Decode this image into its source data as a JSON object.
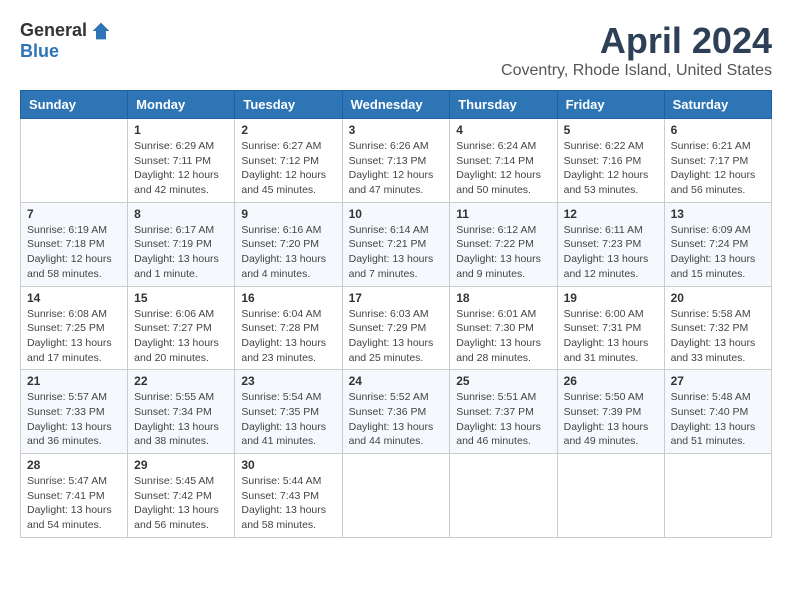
{
  "header": {
    "logo_general": "General",
    "logo_blue": "Blue",
    "month_title": "April 2024",
    "location": "Coventry, Rhode Island, United States"
  },
  "weekdays": [
    "Sunday",
    "Monday",
    "Tuesday",
    "Wednesday",
    "Thursday",
    "Friday",
    "Saturday"
  ],
  "weeks": [
    [
      {
        "day": "",
        "sunrise": "",
        "sunset": "",
        "daylight": ""
      },
      {
        "day": "1",
        "sunrise": "Sunrise: 6:29 AM",
        "sunset": "Sunset: 7:11 PM",
        "daylight": "Daylight: 12 hours and 42 minutes."
      },
      {
        "day": "2",
        "sunrise": "Sunrise: 6:27 AM",
        "sunset": "Sunset: 7:12 PM",
        "daylight": "Daylight: 12 hours and 45 minutes."
      },
      {
        "day": "3",
        "sunrise": "Sunrise: 6:26 AM",
        "sunset": "Sunset: 7:13 PM",
        "daylight": "Daylight: 12 hours and 47 minutes."
      },
      {
        "day": "4",
        "sunrise": "Sunrise: 6:24 AM",
        "sunset": "Sunset: 7:14 PM",
        "daylight": "Daylight: 12 hours and 50 minutes."
      },
      {
        "day": "5",
        "sunrise": "Sunrise: 6:22 AM",
        "sunset": "Sunset: 7:16 PM",
        "daylight": "Daylight: 12 hours and 53 minutes."
      },
      {
        "day": "6",
        "sunrise": "Sunrise: 6:21 AM",
        "sunset": "Sunset: 7:17 PM",
        "daylight": "Daylight: 12 hours and 56 minutes."
      }
    ],
    [
      {
        "day": "7",
        "sunrise": "Sunrise: 6:19 AM",
        "sunset": "Sunset: 7:18 PM",
        "daylight": "Daylight: 12 hours and 58 minutes."
      },
      {
        "day": "8",
        "sunrise": "Sunrise: 6:17 AM",
        "sunset": "Sunset: 7:19 PM",
        "daylight": "Daylight: 13 hours and 1 minute."
      },
      {
        "day": "9",
        "sunrise": "Sunrise: 6:16 AM",
        "sunset": "Sunset: 7:20 PM",
        "daylight": "Daylight: 13 hours and 4 minutes."
      },
      {
        "day": "10",
        "sunrise": "Sunrise: 6:14 AM",
        "sunset": "Sunset: 7:21 PM",
        "daylight": "Daylight: 13 hours and 7 minutes."
      },
      {
        "day": "11",
        "sunrise": "Sunrise: 6:12 AM",
        "sunset": "Sunset: 7:22 PM",
        "daylight": "Daylight: 13 hours and 9 minutes."
      },
      {
        "day": "12",
        "sunrise": "Sunrise: 6:11 AM",
        "sunset": "Sunset: 7:23 PM",
        "daylight": "Daylight: 13 hours and 12 minutes."
      },
      {
        "day": "13",
        "sunrise": "Sunrise: 6:09 AM",
        "sunset": "Sunset: 7:24 PM",
        "daylight": "Daylight: 13 hours and 15 minutes."
      }
    ],
    [
      {
        "day": "14",
        "sunrise": "Sunrise: 6:08 AM",
        "sunset": "Sunset: 7:25 PM",
        "daylight": "Daylight: 13 hours and 17 minutes."
      },
      {
        "day": "15",
        "sunrise": "Sunrise: 6:06 AM",
        "sunset": "Sunset: 7:27 PM",
        "daylight": "Daylight: 13 hours and 20 minutes."
      },
      {
        "day": "16",
        "sunrise": "Sunrise: 6:04 AM",
        "sunset": "Sunset: 7:28 PM",
        "daylight": "Daylight: 13 hours and 23 minutes."
      },
      {
        "day": "17",
        "sunrise": "Sunrise: 6:03 AM",
        "sunset": "Sunset: 7:29 PM",
        "daylight": "Daylight: 13 hours and 25 minutes."
      },
      {
        "day": "18",
        "sunrise": "Sunrise: 6:01 AM",
        "sunset": "Sunset: 7:30 PM",
        "daylight": "Daylight: 13 hours and 28 minutes."
      },
      {
        "day": "19",
        "sunrise": "Sunrise: 6:00 AM",
        "sunset": "Sunset: 7:31 PM",
        "daylight": "Daylight: 13 hours and 31 minutes."
      },
      {
        "day": "20",
        "sunrise": "Sunrise: 5:58 AM",
        "sunset": "Sunset: 7:32 PM",
        "daylight": "Daylight: 13 hours and 33 minutes."
      }
    ],
    [
      {
        "day": "21",
        "sunrise": "Sunrise: 5:57 AM",
        "sunset": "Sunset: 7:33 PM",
        "daylight": "Daylight: 13 hours and 36 minutes."
      },
      {
        "day": "22",
        "sunrise": "Sunrise: 5:55 AM",
        "sunset": "Sunset: 7:34 PM",
        "daylight": "Daylight: 13 hours and 38 minutes."
      },
      {
        "day": "23",
        "sunrise": "Sunrise: 5:54 AM",
        "sunset": "Sunset: 7:35 PM",
        "daylight": "Daylight: 13 hours and 41 minutes."
      },
      {
        "day": "24",
        "sunrise": "Sunrise: 5:52 AM",
        "sunset": "Sunset: 7:36 PM",
        "daylight": "Daylight: 13 hours and 44 minutes."
      },
      {
        "day": "25",
        "sunrise": "Sunrise: 5:51 AM",
        "sunset": "Sunset: 7:37 PM",
        "daylight": "Daylight: 13 hours and 46 minutes."
      },
      {
        "day": "26",
        "sunrise": "Sunrise: 5:50 AM",
        "sunset": "Sunset: 7:39 PM",
        "daylight": "Daylight: 13 hours and 49 minutes."
      },
      {
        "day": "27",
        "sunrise": "Sunrise: 5:48 AM",
        "sunset": "Sunset: 7:40 PM",
        "daylight": "Daylight: 13 hours and 51 minutes."
      }
    ],
    [
      {
        "day": "28",
        "sunrise": "Sunrise: 5:47 AM",
        "sunset": "Sunset: 7:41 PM",
        "daylight": "Daylight: 13 hours and 54 minutes."
      },
      {
        "day": "29",
        "sunrise": "Sunrise: 5:45 AM",
        "sunset": "Sunset: 7:42 PM",
        "daylight": "Daylight: 13 hours and 56 minutes."
      },
      {
        "day": "30",
        "sunrise": "Sunrise: 5:44 AM",
        "sunset": "Sunset: 7:43 PM",
        "daylight": "Daylight: 13 hours and 58 minutes."
      },
      {
        "day": "",
        "sunrise": "",
        "sunset": "",
        "daylight": ""
      },
      {
        "day": "",
        "sunrise": "",
        "sunset": "",
        "daylight": ""
      },
      {
        "day": "",
        "sunrise": "",
        "sunset": "",
        "daylight": ""
      },
      {
        "day": "",
        "sunrise": "",
        "sunset": "",
        "daylight": ""
      }
    ]
  ]
}
